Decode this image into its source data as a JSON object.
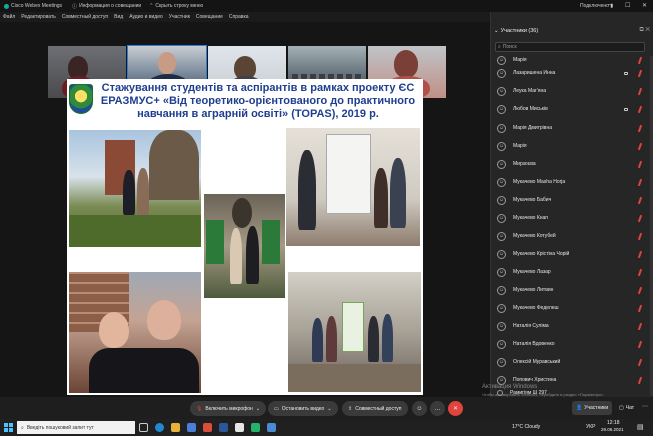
{
  "titlebar": {
    "app_name": "Cisco Webex Meetings",
    "info_label": "Информация о совещании",
    "hide_label": "Скрыть строку меню",
    "connection_label": "Подключено",
    "minimize": "–",
    "maximize": "☐",
    "close": "✕"
  },
  "menu": [
    "Файл",
    "Редактировать",
    "Совместный доступ",
    "Вид",
    "Аудио и видео",
    "Участник",
    "Совещание",
    "Справка"
  ],
  "videos": [
    {
      "label": ""
    },
    {
      "label": "Анат... (организатор)"
    },
    {
      "label": ""
    },
    {
      "label": ""
    },
    {
      "label": ""
    }
  ],
  "slide": {
    "title": "Стажування студентів та аспірантів в рамках проекту ЄС ЕРАЗМУС+ «Від теоретико-орієнтованого до практичного навчання в аграрній освіті» (TOPAS), 2019 р."
  },
  "participants": {
    "header": "Участники (36)",
    "search_placeholder": "Поиск",
    "items": [
      {
        "name": "Марія"
      },
      {
        "name": "Лазаришена Инна"
      },
      {
        "name": "Леука Маг'яна"
      },
      {
        "name": "Любов Миськів"
      },
      {
        "name": "Марія Дмитрівна"
      },
      {
        "name": "Марія"
      },
      {
        "name": "Мирзоєва"
      },
      {
        "name": "Мукачево Masha Horja"
      },
      {
        "name": "Мукачево Бабич"
      },
      {
        "name": "Мукачево Кнап"
      },
      {
        "name": "Мукачево Котубей"
      },
      {
        "name": "Мукачево Крістіна Чорій"
      },
      {
        "name": "Мукачево Лазар"
      },
      {
        "name": "Мукачево Литвин"
      },
      {
        "name": "Мукачево Феделеш"
      },
      {
        "name": "Наталія Суліма"
      },
      {
        "name": "Наталія Вдовенко"
      },
      {
        "name": "Олексій Муравський"
      },
      {
        "name": "Попович Христина"
      },
      {
        "name": "Рамигіям Ш 297"
      }
    ]
  },
  "toolbar": {
    "mic_label": "Включить микрофон",
    "video_label": "Остановить видео",
    "share_label": "Совместный доступ",
    "participants_label": "Участники",
    "chat_label": "Чат",
    "more": "…",
    "end": "✕"
  },
  "watermark": {
    "line1": "Активация Windows",
    "line2": "Чтобы активировать Windows, перейдите в раздел «Параметры»."
  },
  "taskbar": {
    "search_placeholder": "Введіть пошуковий запит тут",
    "weather": "17°C Cloudy",
    "lang": "УКР",
    "time": "12:18",
    "date": "29.06.2021"
  },
  "colors": {
    "accent": "#2a7de1",
    "end_call": "#e0443c",
    "slide_title": "#1e3e8f"
  }
}
